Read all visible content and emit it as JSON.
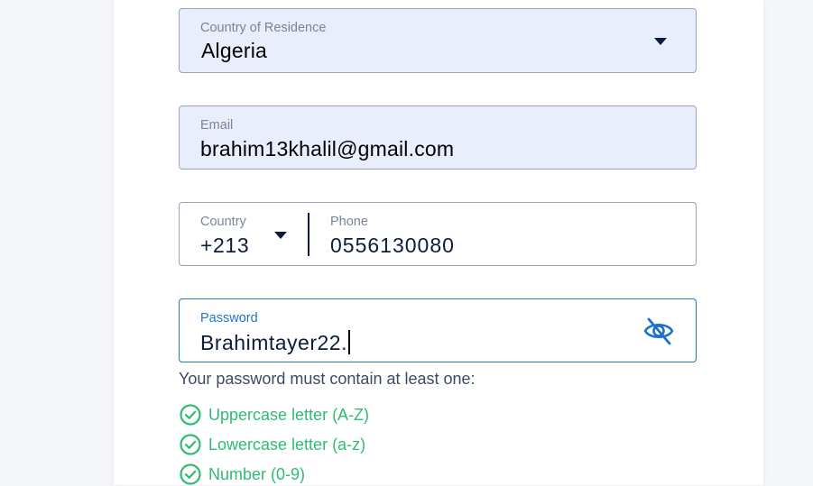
{
  "form": {
    "residence": {
      "label": "Country of Residence",
      "value": "Algeria"
    },
    "email": {
      "label": "Email",
      "value": "brahim13khalil@gmail.com"
    },
    "phone": {
      "country_label": "Country",
      "country_value": "+213",
      "label": "Phone",
      "value": "0556130080"
    },
    "password": {
      "label": "Password",
      "value": "Brahimtayer22.",
      "toggle_icon": "eye-slash-icon"
    },
    "requirements": {
      "intro": "Your password must contain at least one:",
      "items": [
        {
          "label": "Uppercase letter (A-Z)",
          "met": true
        },
        {
          "label": "Lowercase letter (a-z)",
          "met": true
        },
        {
          "label": "Number (0-9)",
          "met": true
        }
      ]
    }
  },
  "colors": {
    "accent_focus": "#1e78c8",
    "success": "#2ebd72",
    "text_primary": "#0d1b3e"
  }
}
